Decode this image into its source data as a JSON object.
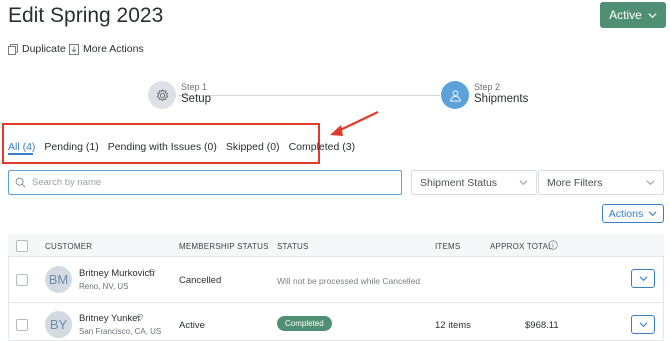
{
  "page": {
    "title": "Edit Spring 2023"
  },
  "status_button": {
    "label": "Active"
  },
  "actions_bar": {
    "duplicate": "Duplicate",
    "more_actions": "More Actions"
  },
  "steps": [
    {
      "step": "Step 1",
      "label": "Setup"
    },
    {
      "step": "Step 2",
      "label": "Shipments"
    }
  ],
  "tabs": [
    {
      "label": "All (4)",
      "active": true
    },
    {
      "label": "Pending (1)",
      "active": false
    },
    {
      "label": "Pending with Issues (0)",
      "active": false
    },
    {
      "label": "Skipped (0)",
      "active": false
    },
    {
      "label": "Completed (3)",
      "active": false
    }
  ],
  "search": {
    "placeholder": "Search by name",
    "value": ""
  },
  "filters": {
    "shipment_status": "Shipment Status",
    "more_filters": "More Filters"
  },
  "bulk_actions": {
    "label": "Actions"
  },
  "table": {
    "headers": {
      "customer": "CUSTOMER",
      "membership_status": "MEMBERSHIP STATUS",
      "status": "STATUS",
      "items": "ITEMS",
      "approx_total": "APPROX TOTAL"
    },
    "rows": [
      {
        "initials": "BM",
        "name": "Britney Murkovich",
        "location": "Reno, NV, US",
        "membership_status": "Cancelled",
        "status": "Will not be processed while Cancelled",
        "items": "",
        "total": ""
      },
      {
        "initials": "BY",
        "name": "Britney Yunker",
        "location": "San Francisco, CA, US",
        "membership_status": "Active",
        "status": "Completed",
        "items": "12 items",
        "total": "$968.11"
      }
    ]
  },
  "colors": {
    "accent": "#3a7ec8",
    "brand_green": "#4f8f73",
    "highlight_red": "#e13a2b",
    "step_active": "#5aa2d8"
  }
}
